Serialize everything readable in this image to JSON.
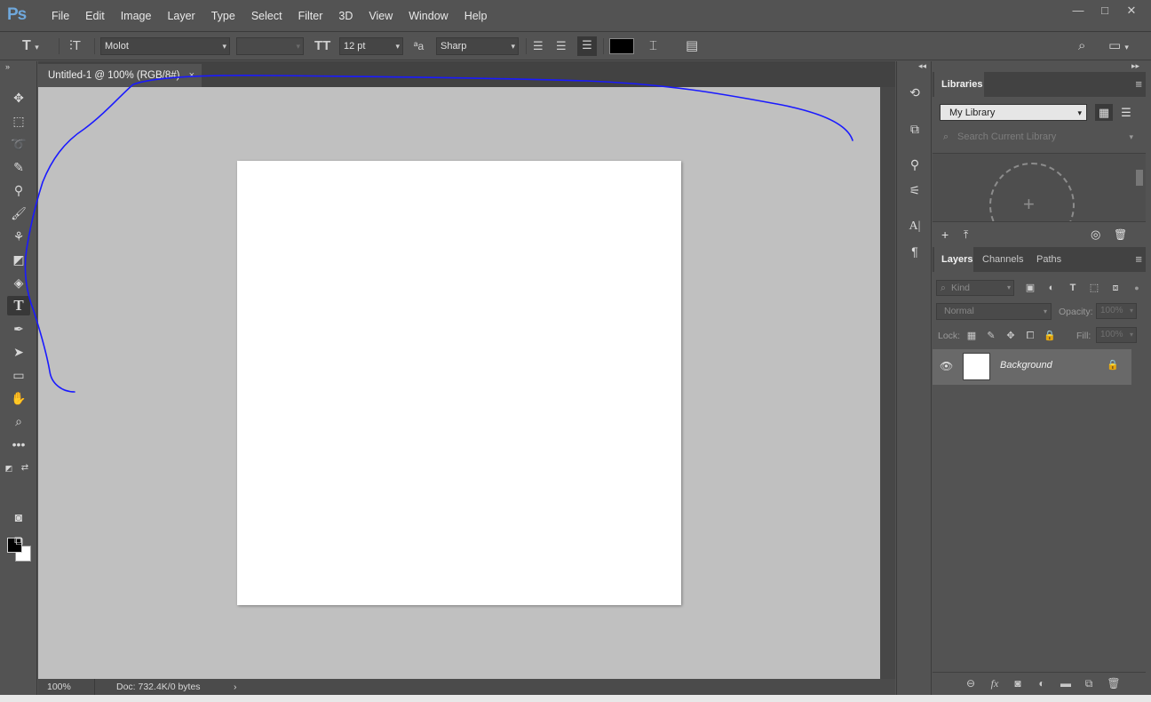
{
  "app": {
    "logo": "Ps"
  },
  "menu": [
    "File",
    "Edit",
    "Image",
    "Layer",
    "Type",
    "Select",
    "Filter",
    "3D",
    "View",
    "Window",
    "Help"
  ],
  "window_controls": {
    "minimize": "—",
    "maximize": "□",
    "close": "✕"
  },
  "options": {
    "tool_icon": "T",
    "font_family": "Molot",
    "font_style": "",
    "font_size": "12 pt",
    "aa_label": "ªa",
    "antialias": "Sharp",
    "text_color": "#000000"
  },
  "document": {
    "tab_title": "Untitled-1 @ 100% (RGB/8#)",
    "tab_close": "×",
    "zoom": "100%",
    "doc_info": "Doc: 732.4K/0 bytes",
    "status_arrow": "›"
  },
  "libraries": {
    "tab": "Libraries",
    "library_name": "My Library",
    "search_placeholder": "Search Current Library"
  },
  "layers_panel": {
    "tabs": [
      "Layers",
      "Channels",
      "Paths"
    ],
    "kind_label": "Kind",
    "blend_mode": "Normal",
    "opacity_label": "Opacity:",
    "opacity_value": "100%",
    "lock_label": "Lock:",
    "fill_label": "Fill:",
    "fill_value": "100%",
    "layer_name": "Background"
  },
  "colors": {
    "ui_bg": "#535353",
    "canvas_bg": "#c0c0c0",
    "stroke": "#1a1aff",
    "foreground_swatch": "#000000",
    "background_swatch": "#ffffff"
  }
}
